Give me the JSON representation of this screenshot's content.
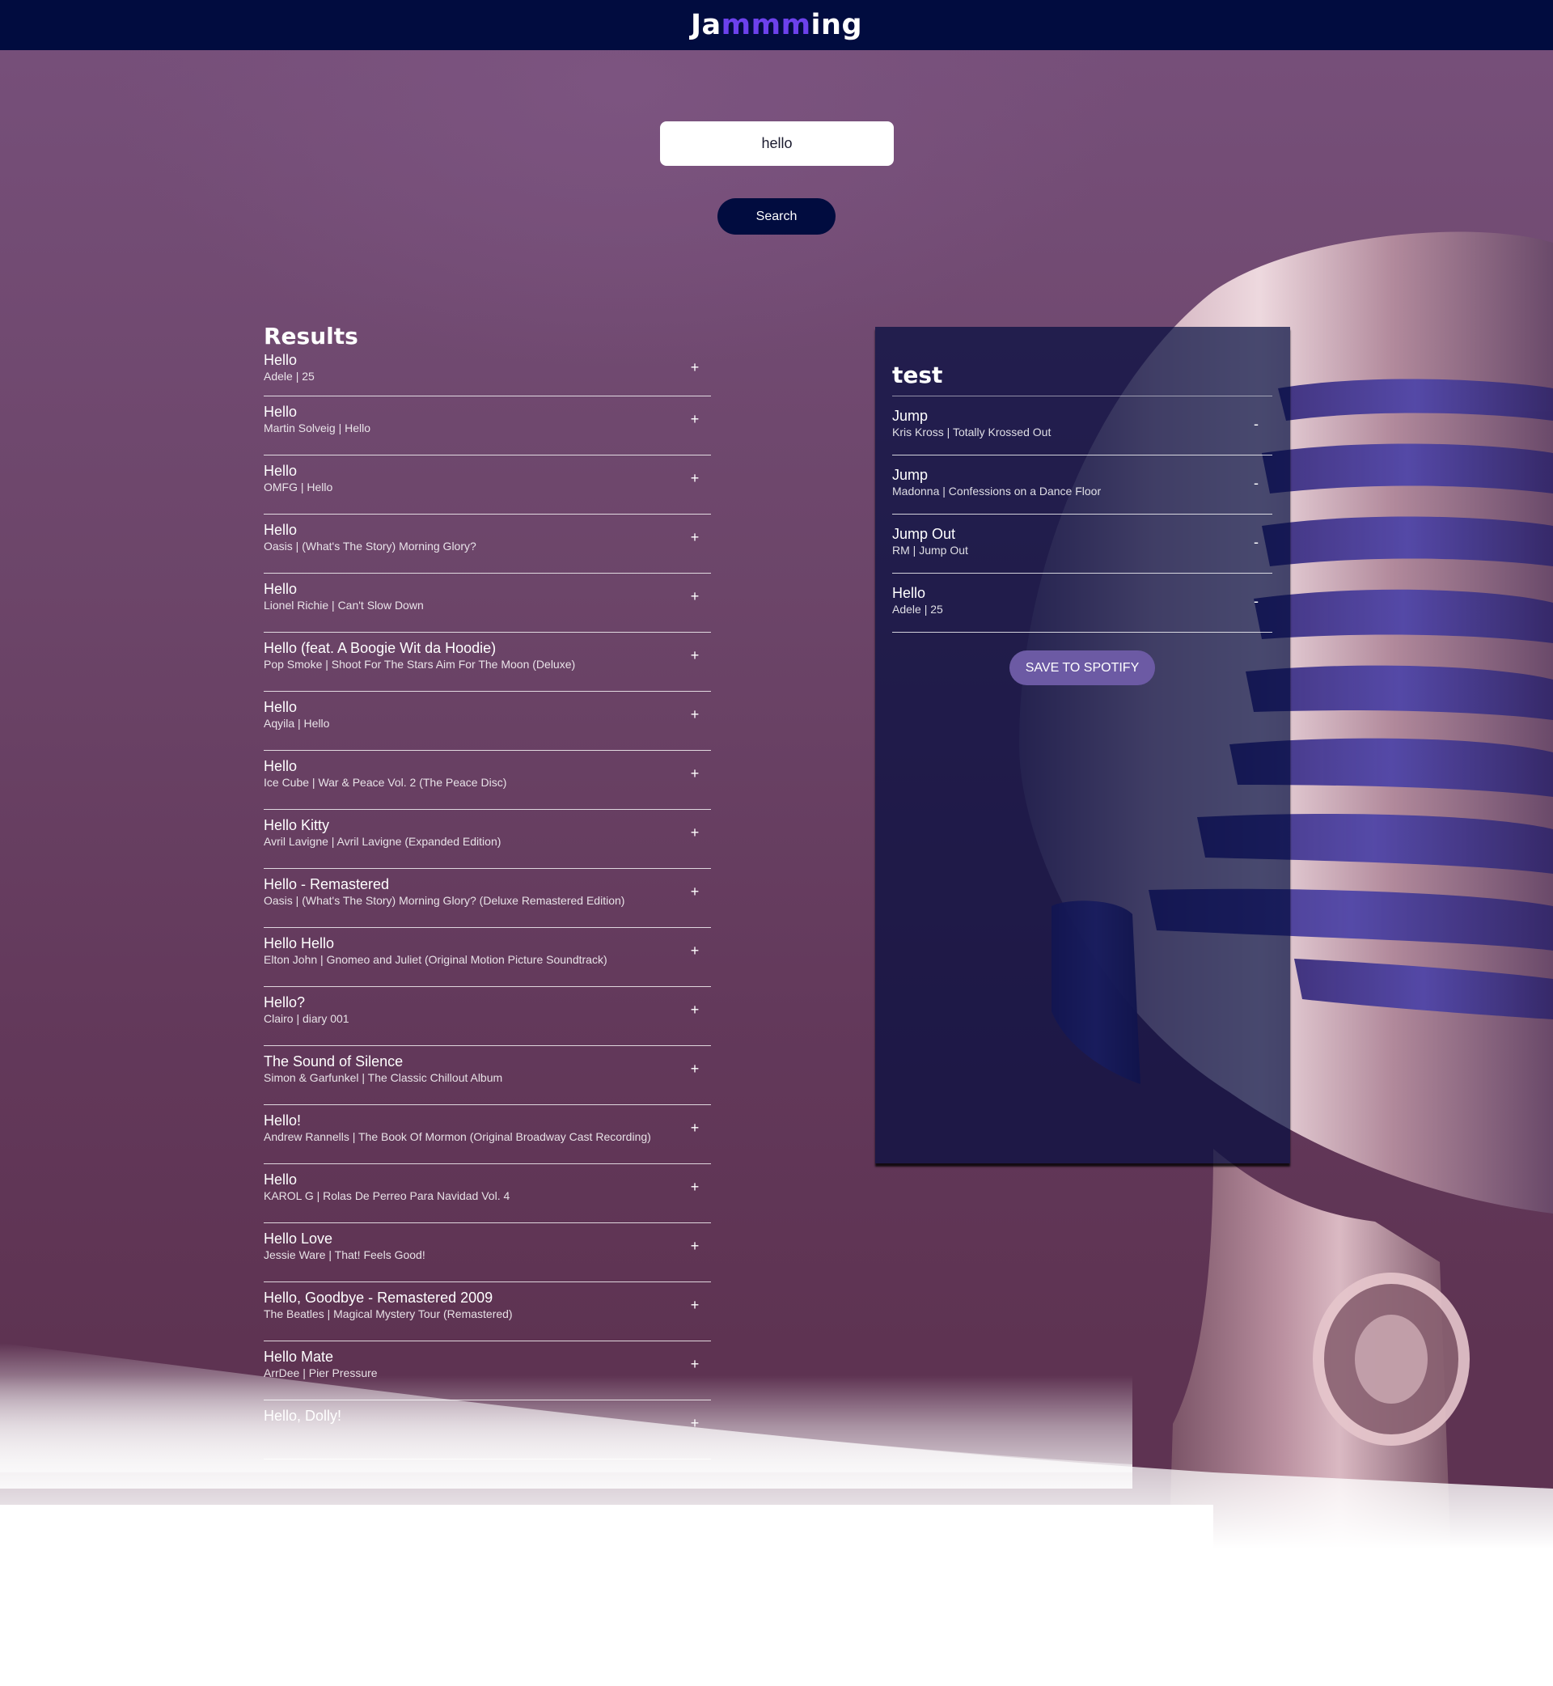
{
  "header": {
    "logo_prefix": "Ja",
    "logo_accent": "mmm",
    "logo_suffix": "ing",
    "accent_color": "#6c41ec",
    "background_color": "#010c3f"
  },
  "search": {
    "value": "hello",
    "button_label": "Search"
  },
  "results": {
    "title": "Results",
    "action_symbol": "+",
    "tracks": [
      {
        "name": "Hello",
        "info": "Adele | 25"
      },
      {
        "name": "Hello",
        "info": "Martin Solveig | Hello"
      },
      {
        "name": "Hello",
        "info": "OMFG | Hello"
      },
      {
        "name": "Hello",
        "info": "Oasis | (What's The Story) Morning Glory?"
      },
      {
        "name": "Hello",
        "info": "Lionel Richie | Can't Slow Down"
      },
      {
        "name": "Hello (feat. A Boogie Wit da Hoodie)",
        "info": "Pop Smoke | Shoot For The Stars Aim For The Moon (Deluxe)"
      },
      {
        "name": "Hello",
        "info": "Aqyila | Hello"
      },
      {
        "name": "Hello",
        "info": "Ice Cube | War & Peace Vol. 2 (The Peace Disc)"
      },
      {
        "name": "Hello Kitty",
        "info": "Avril Lavigne | Avril Lavigne (Expanded Edition)"
      },
      {
        "name": "Hello - Remastered",
        "info": "Oasis | (What's The Story) Morning Glory? (Deluxe Remastered Edition)"
      },
      {
        "name": "Hello Hello",
        "info": "Elton John | Gnomeo and Juliet (Original Motion Picture Soundtrack)"
      },
      {
        "name": "Hello?",
        "info": "Clairo | diary 001"
      },
      {
        "name": "The Sound of Silence",
        "info": "Simon & Garfunkel | The Classic Chillout Album"
      },
      {
        "name": "Hello!",
        "info": "Andrew Rannells | The Book Of Mormon (Original Broadway Cast Recording)"
      },
      {
        "name": "Hello",
        "info": "KAROL G | Rolas De Perreo Para Navidad Vol. 4"
      },
      {
        "name": "Hello Love",
        "info": "Jessie Ware | That! Feels Good!"
      },
      {
        "name": "Hello, Goodbye - Remastered 2009",
        "info": "The Beatles | Magical Mystery Tour (Remastered)"
      },
      {
        "name": "Hello Mate",
        "info": "ArrDee | Pier Pressure"
      },
      {
        "name": "Hello, Dolly!",
        "info": ""
      }
    ]
  },
  "playlist": {
    "name": "test",
    "action_symbol": "-",
    "save_label": "SAVE TO SPOTIFY",
    "save_color": "#6c5aa4",
    "tracks": [
      {
        "name": "Jump",
        "info": "Kris Kross | Totally Krossed Out"
      },
      {
        "name": "Jump",
        "info": "Madonna | Confessions on a Dance Floor"
      },
      {
        "name": "Jump Out",
        "info": "RM | Jump Out"
      },
      {
        "name": "Hello",
        "info": "Adele | 25"
      }
    ]
  },
  "background": {
    "image": "microphone-photo"
  }
}
